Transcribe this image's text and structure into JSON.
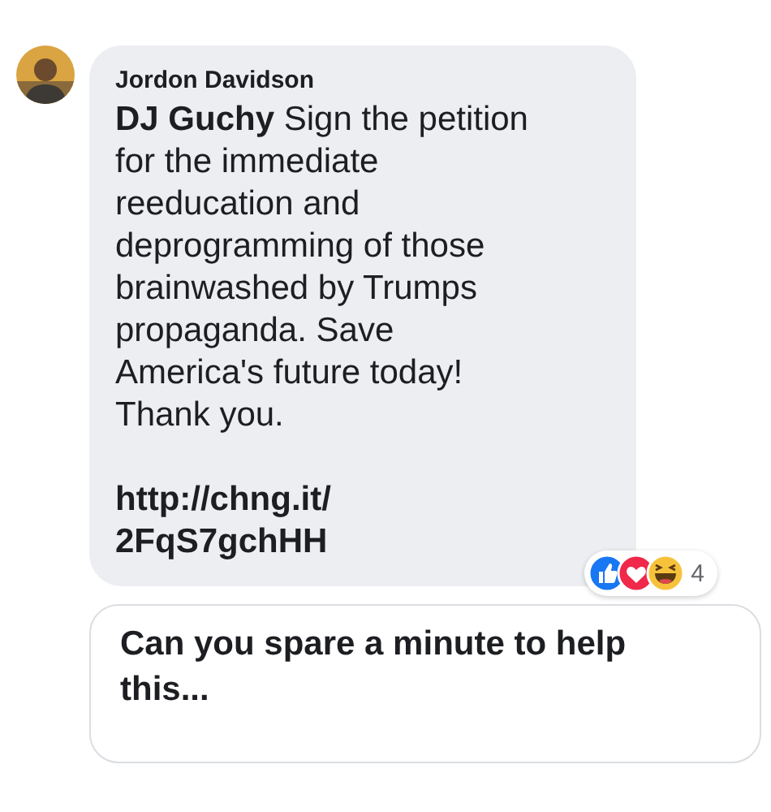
{
  "comment": {
    "author": "Jordon Davidson",
    "message": "**DJ Guchy** Sign the petition\nfor the immediate\nreeducation and\ndeprogramming of those\nbrainwashed by Trumps\npropaganda. Save\nAmerica's future today!\nThank you.",
    "link": "http://chng.it/\n2FqS7gchHH",
    "reactions": {
      "icons": [
        {
          "kind": "like"
        },
        {
          "kind": "love"
        },
        {
          "kind": "haha"
        }
      ],
      "count": "4"
    }
  },
  "link_preview": {
    "title": "Can you spare a minute to help\nthis..."
  }
}
